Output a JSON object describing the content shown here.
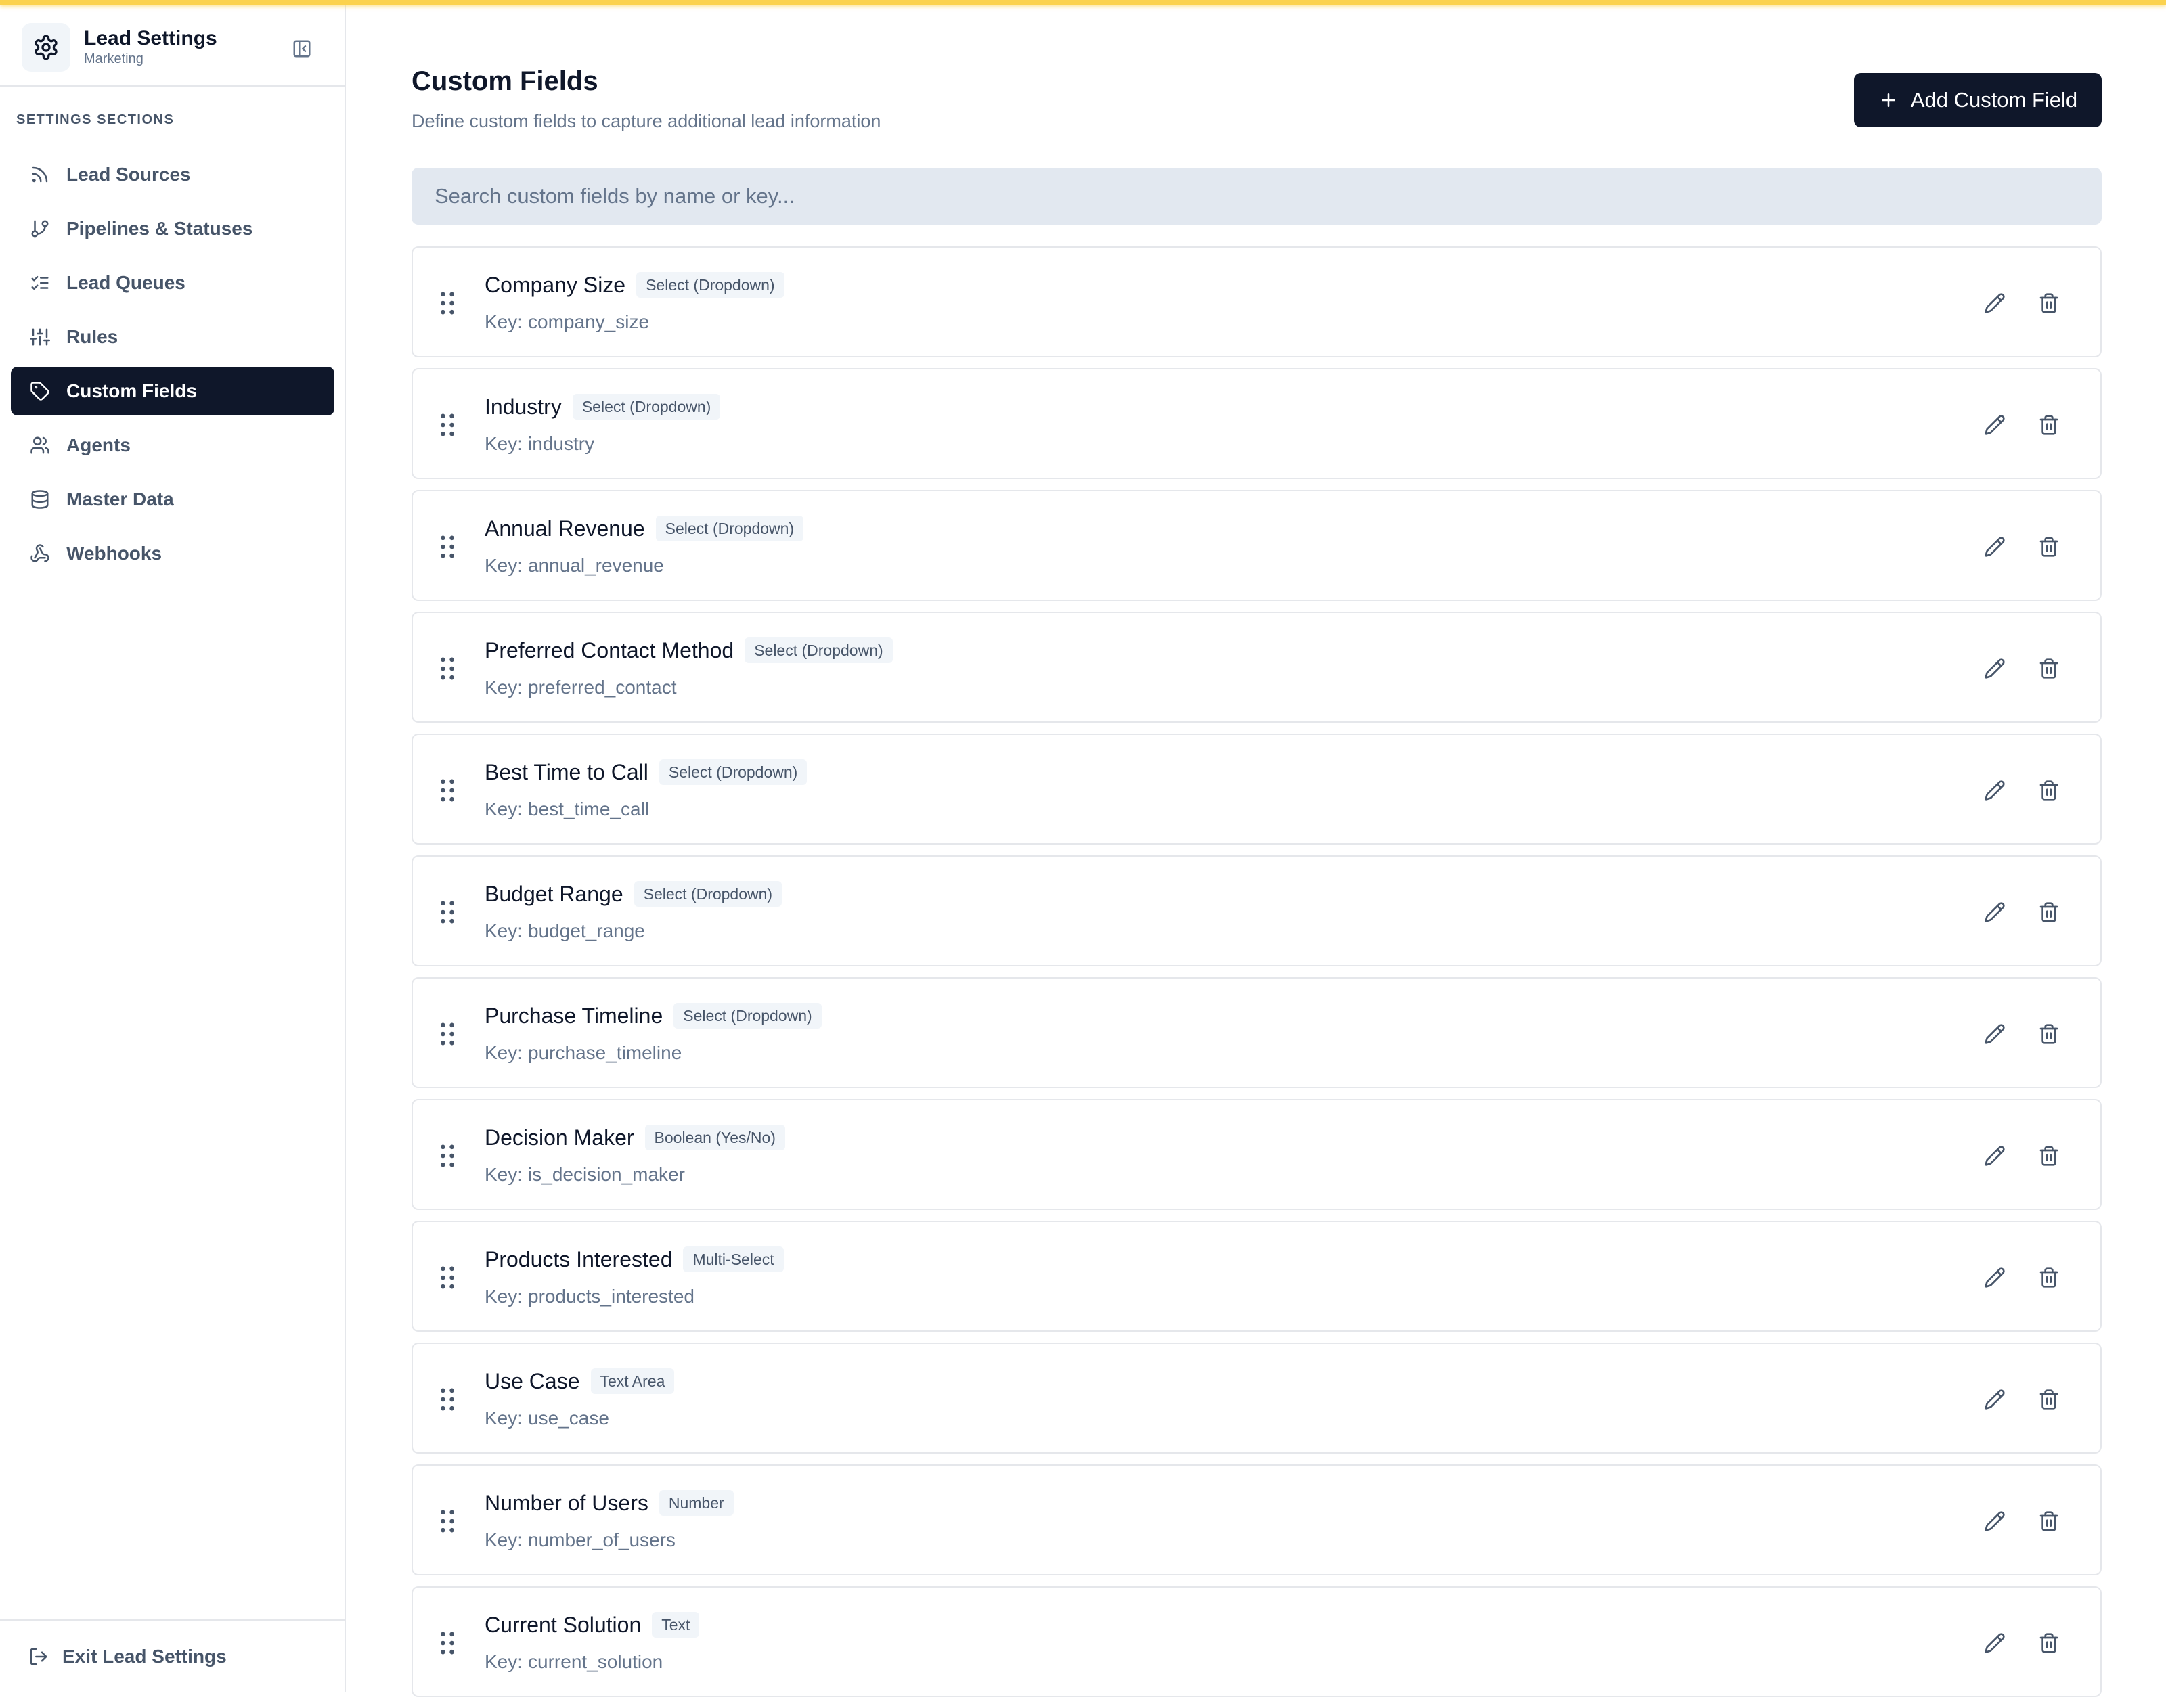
{
  "app": {
    "title": "Lead Settings",
    "subtitle": "Marketing"
  },
  "sidebar": {
    "section_label": "SETTINGS SECTIONS",
    "items": [
      {
        "label": "Lead Sources",
        "icon": "rss-icon",
        "active": false
      },
      {
        "label": "Pipelines & Statuses",
        "icon": "git-branch-icon",
        "active": false
      },
      {
        "label": "Lead Queues",
        "icon": "list-checks-icon",
        "active": false
      },
      {
        "label": "Rules",
        "icon": "sliders-icon",
        "active": true
      },
      {
        "label": "Custom Fields",
        "icon": "tag-icon",
        "active": true
      },
      {
        "label": "Agents",
        "icon": "users-icon",
        "active": false
      },
      {
        "label": "Master Data",
        "icon": "database-icon",
        "active": false
      },
      {
        "label": "Webhooks",
        "icon": "webhook-icon",
        "active": false
      }
    ],
    "footer_label": "Exit Lead Settings"
  },
  "main": {
    "title": "Custom Fields",
    "subtitle": "Define custom fields to capture additional lead information",
    "add_button_label": "Add Custom Field",
    "search_placeholder": "Search custom fields by name or key...",
    "key_prefix": "Key:",
    "fields": [
      {
        "name": "Company Size",
        "type": "Select (Dropdown)",
        "key": "company_size"
      },
      {
        "name": "Industry",
        "type": "Select (Dropdown)",
        "key": "industry"
      },
      {
        "name": "Annual Revenue",
        "type": "Select (Dropdown)",
        "key": "annual_revenue"
      },
      {
        "name": "Preferred Contact Method",
        "type": "Select (Dropdown)",
        "key": "preferred_contact"
      },
      {
        "name": "Best Time to Call",
        "type": "Select (Dropdown)",
        "key": "best_time_call"
      },
      {
        "name": "Budget Range",
        "type": "Select (Dropdown)",
        "key": "budget_range"
      },
      {
        "name": "Purchase Timeline",
        "type": "Select (Dropdown)",
        "key": "purchase_timeline"
      },
      {
        "name": "Decision Maker",
        "type": "Boolean (Yes/No)",
        "key": "is_decision_maker"
      },
      {
        "name": "Products Interested",
        "type": "Multi-Select",
        "key": "products_interested"
      },
      {
        "name": "Use Case",
        "type": "Text Area",
        "key": "use_case"
      },
      {
        "name": "Number of Users",
        "type": "Number",
        "key": "number_of_users"
      },
      {
        "name": "Current Solution",
        "type": "Text",
        "key": "current_solution"
      }
    ]
  },
  "colors": {
    "accent_bar": "#fbd24e",
    "primary": "#0f172a",
    "muted_text": "#64748b",
    "border": "#e5e7eb",
    "search_bg": "#e2e8f0"
  }
}
